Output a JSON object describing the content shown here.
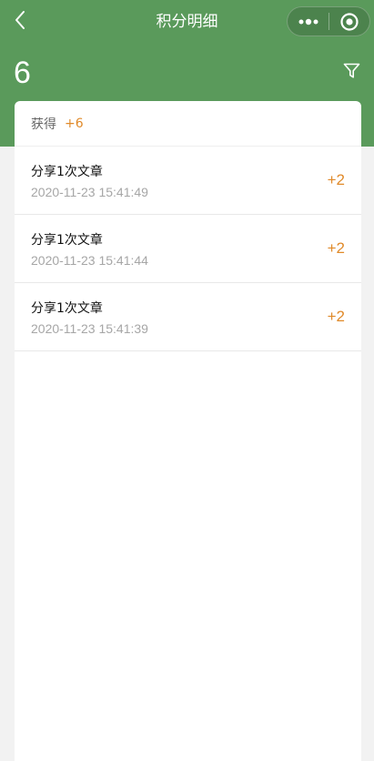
{
  "nav": {
    "title": "积分明细",
    "back_icon": "chevron-left-icon",
    "more_icon": "more-dots-icon",
    "close_icon": "target-circle-icon"
  },
  "header": {
    "total_points": "6",
    "background_color": "#5a9a5b",
    "filter_icon": "filter-icon"
  },
  "summary": {
    "label": "获得",
    "value": "+6",
    "value_color": "#e08a2a"
  },
  "records": [
    {
      "title": "分享1次文章",
      "time": "2020-11-23 15:41:49",
      "delta": "+2"
    },
    {
      "title": "分享1次文章",
      "time": "2020-11-23 15:41:44",
      "delta": "+2"
    },
    {
      "title": "分享1次文章",
      "time": "2020-11-23 15:41:39",
      "delta": "+2"
    }
  ]
}
